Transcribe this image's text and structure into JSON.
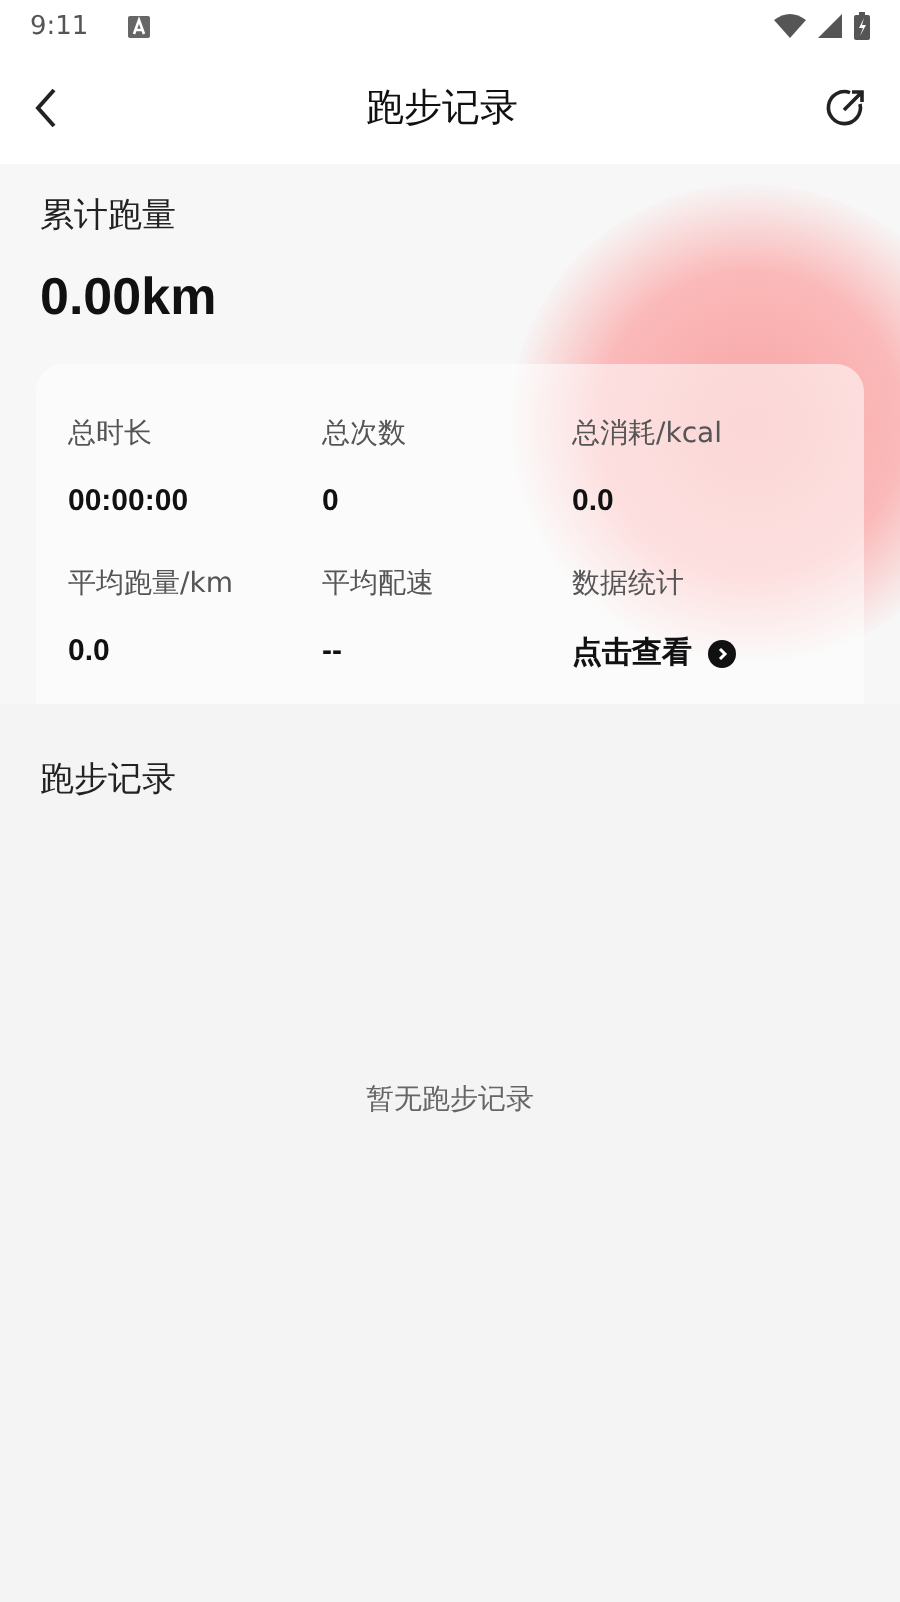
{
  "status_bar": {
    "time": "9:11"
  },
  "header": {
    "title": "跑步记录"
  },
  "summary": {
    "label": "累计跑量",
    "total": "0.00km"
  },
  "stats": [
    {
      "kind": "value",
      "label": "总时长",
      "value": "00:00:00"
    },
    {
      "kind": "value",
      "label": "总次数",
      "value": "0"
    },
    {
      "kind": "value",
      "label": "总消耗/kcal",
      "value": "0.0"
    },
    {
      "kind": "value",
      "label": "平均跑量/km",
      "value": "0.0"
    },
    {
      "kind": "value",
      "label": "平均配速",
      "value": "--"
    },
    {
      "kind": "link",
      "label": "数据统计",
      "value": "点击查看"
    }
  ],
  "records": {
    "title": "跑步记录",
    "empty_text": "暂无跑步记录"
  }
}
